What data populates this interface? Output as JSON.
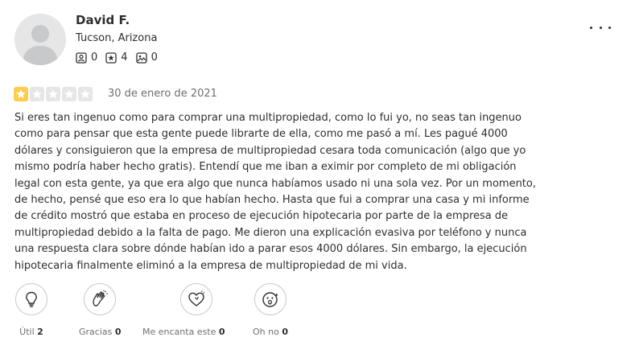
{
  "user": {
    "name": "David F.",
    "location": "Tucson, Arizona",
    "stats": [
      {
        "icon": "friends-icon",
        "value": "0"
      },
      {
        "icon": "reviews-icon",
        "value": "4"
      },
      {
        "icon": "photos-icon",
        "value": "0"
      }
    ]
  },
  "menu": {
    "icon": "more-options-icon"
  },
  "review": {
    "rating": 1,
    "rating_max": 5,
    "date": "30 de enero de 2021",
    "text": "Si eres tan ingenuo como para comprar una multipropiedad, como lo fui yo, no seas tan ingenuo\ncomo para pensar que esta gente puede librarte de ella, como me pasó a mí. Les pagué 4000\ndólares y consiguieron que la empresa de multipropiedad cesara toda comunicación (algo que yo\nmismo podría haber hecho gratis). Entendí que me iban a eximir por completo de mi obligación\nlegal con esta gente, ya que era algo que nunca habíamos usado ni una sola vez. Por un momento,\nde hecho, pensé que eso era lo que habían hecho. Hasta que fui a comprar una casa y mi informe\nde crédito mostró que estaba en proceso de ejecución hipotecaria por parte de la empresa de\nmultipropiedad debido a la falta de pago. Me dieron una explicación evasiva por teléfono y nunca\nuna respuesta clara sobre dónde habían ido a parar esos 4000 dólares. Sin embargo, la ejecución\nhipotecaria finalmente eliminó a la empresa de multipropiedad de mi vida."
  },
  "reactions": [
    {
      "label": "Útil",
      "count": "2",
      "icon": "lightbulb-icon"
    },
    {
      "label": "Gracias",
      "count": "0",
      "icon": "clapping-hands-icon"
    },
    {
      "label": "Me encanta este",
      "count": "0",
      "icon": "heart-icon"
    },
    {
      "label": "Oh no",
      "count": "0",
      "icon": "surprised-face-icon"
    }
  ],
  "colors": {
    "star_filled": "#ffcc4b",
    "star_empty": "#e6e6e6",
    "text": "#2d2e2f",
    "muted": "#6e7072"
  }
}
